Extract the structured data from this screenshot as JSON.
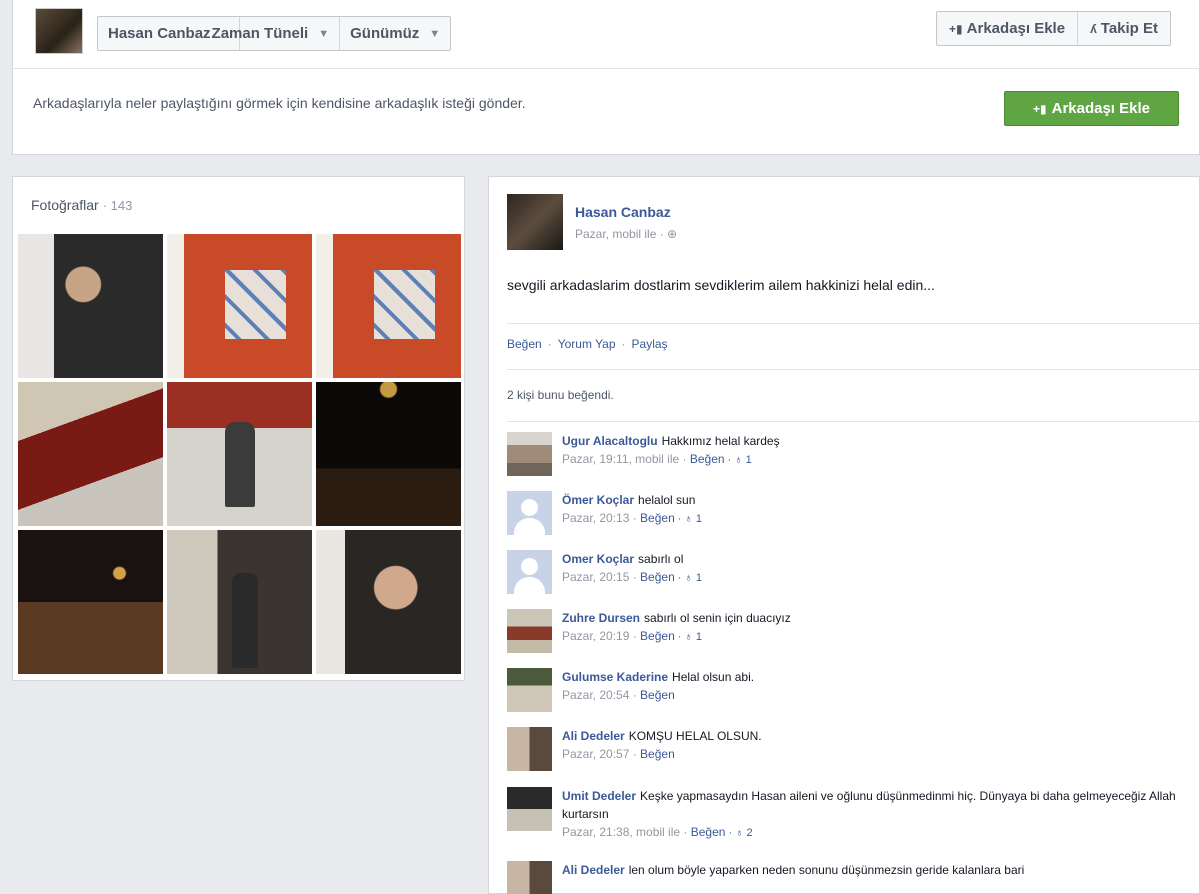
{
  "header": {
    "profile_name": "Hasan Canbaz",
    "nav_timeline": "Zaman Tüneli",
    "nav_today": "Günümüz",
    "add_friend_label": "Arkadaşı Ekle",
    "follow_label": "Takip Et"
  },
  "request": {
    "text": "Arkadaşlarıyla neler paylaştığını görmek için kendisine arkadaşlık isteği gönder.",
    "button_label": "Arkadaşı Ekle"
  },
  "photos": {
    "title": "Fotoğraflar",
    "count": "· 143"
  },
  "post": {
    "author": "Hasan Canbaz",
    "meta": "Pazar, mobil ile · ⊕",
    "text": "sevgili arkadaslarim dostlarim sevdiklerim ailem hakkinizi helal edin...",
    "actions": {
      "like": "Beğen",
      "comment": "Yorum Yap",
      "share": "Paylaş"
    },
    "likes_summary": "2 kişi bunu beğendi."
  },
  "comments": [
    {
      "author": "Ugur Alacaltoglu",
      "text": "Hakkımız helal kardeş",
      "meta": "Pazar, 19:11, mobil ile · ",
      "like": "Beğen",
      "likes": " · ♁ 1"
    },
    {
      "author": "Ömer Koçlar",
      "text": "helalol sun",
      "meta": "Pazar, 20:13 · ",
      "like": "Beğen",
      "likes": " · ♁ 1"
    },
    {
      "author": "Omer Koçlar",
      "text": "sabırlı ol",
      "meta": "Pazar, 20:15 · ",
      "like": "Beğen",
      "likes": " · ♁ 1"
    },
    {
      "author": "Zuhre Dursen",
      "text": "sabırlı ol senin için duacıyız",
      "meta": "Pazar, 20:19 · ",
      "like": "Beğen",
      "likes": " · ♁ 1"
    },
    {
      "author": "Gulumse Kaderine",
      "text": "Helal olsun abi.",
      "meta": "Pazar, 20:54 · ",
      "like": "Beğen",
      "likes": ""
    },
    {
      "author": "Ali Dedeler",
      "text": "KOMŞU HELAL OLSUN.",
      "meta": "Pazar, 20:57 · ",
      "like": "Beğen",
      "likes": ""
    },
    {
      "author": "Umit Dedeler",
      "text": "Keşke yapmasaydın Hasan aileni ve oğlunu düşünmedinmi hiç. Dünyaya bi daha gelmeyeceğiz Allah kurtarsın",
      "meta": "Pazar, 21:38, mobil ile · ",
      "like": "Beğen",
      "likes": " · ♁ 2"
    },
    {
      "author": "Ali Dedeler",
      "text": "len olum böyle yaparken neden sonunu düşünmezsin geride kalanlara bari",
      "meta": "",
      "like": "",
      "likes": ""
    }
  ]
}
